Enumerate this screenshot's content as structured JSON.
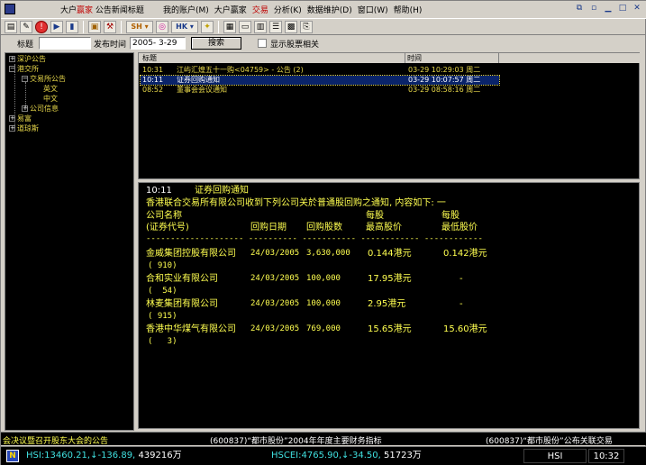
{
  "window": {
    "title_prefix": "大户",
    "title_brand": "赢家",
    "title_suffix": "公告新闻标题",
    "controls": [
      "⧉",
      "▫",
      "▁",
      "□",
      "✕"
    ]
  },
  "menu": [
    {
      "label": "我的账户(M)",
      "active": false
    },
    {
      "label": "大户赢家",
      "active": false
    },
    {
      "label": "交易",
      "active": true
    },
    {
      "label": "分析(K)",
      "active": false
    },
    {
      "label": "数据维护(D)",
      "active": false
    },
    {
      "label": "窗口(W)",
      "active": false
    },
    {
      "label": "帮助(H)",
      "active": false
    }
  ],
  "toolbar": {
    "sh_label": "SH ▾",
    "index_label": "HK ▾"
  },
  "filter": {
    "title_label": "标题",
    "title_value": "",
    "date_label": "发布时间",
    "date_value": "2005- 3-29",
    "search_label": "搜索",
    "related_label": "显示股票相关"
  },
  "tree": {
    "items": [
      {
        "label": "深沪公告",
        "box": "+"
      },
      {
        "label": "港交所",
        "box": "−"
      },
      {
        "label": "交易所公告",
        "box": "−"
      },
      {
        "label": "英文",
        "box": ""
      },
      {
        "label": "中文",
        "box": ""
      },
      {
        "label": "公司信息",
        "box": "+"
      },
      {
        "label": "易富",
        "box": "+"
      },
      {
        "label": "道琼斯",
        "box": "+"
      }
    ]
  },
  "news_list": {
    "col_title": "标题",
    "col_time": "时间",
    "rows": [
      {
        "time": "10:31",
        "title": "江屿汇煌五十一购<04759> - 公告 (2)",
        "datetime": "03-29 10:29:03 周二",
        "selected": false
      },
      {
        "time": "10:11",
        "title": "证券回购通知",
        "datetime": "03-29 10:07:57 周二",
        "selected": true
      },
      {
        "time": "08:52",
        "title": "董事会会议通知",
        "datetime": "03-29 08:58:16 周二",
        "selected": false
      }
    ]
  },
  "detail": {
    "time": "10:11",
    "heading": "证券回购通知",
    "intro": "香港联合交易所有限公司收到下列公司关於普通股回购之通知, 内容如下: 一",
    "col_company": "公司名称",
    "col_code": "(证券代号)",
    "col_date": "回购日期",
    "col_shares": "回购股数",
    "col_high_top": "每股",
    "col_high": "最高股价",
    "col_low_top": "每股",
    "col_low": "最低股价",
    "dashes": "-------------------- ---------- ----------- ------------ ------------",
    "rows": [
      {
        "company": "金威集团控股有限公司",
        "code": "( 910)",
        "date": "24/03/2005",
        "shares": "3,630,000",
        "high": "0.144港元",
        "low": "0.142港元"
      },
      {
        "company": "合和实业有限公司",
        "code": "(  54)",
        "date": "24/03/2005",
        "shares": "100,000",
        "high": "17.95港元",
        "low": "-"
      },
      {
        "company": "林麦集团有限公司",
        "code": "( 915)",
        "date": "24/03/2005",
        "shares": "100,000",
        "high": "2.95港元",
        "low": "-"
      },
      {
        "company": "香港中华煤气有限公司",
        "code": "(   3)",
        "date": "24/03/2005",
        "shares": "769,000",
        "high": "15.65港元",
        "low": "15.60港元"
      }
    ]
  },
  "ticker": {
    "left": "会决议暨召开股东大会的公告",
    "mid": "(600837)“都市股份”2004年年度主要财务指标",
    "right": "(600837)“都市股份”公布关联交易"
  },
  "status": {
    "logo": "N",
    "hsi": "HSI:13460.21,↓-136.89,",
    "hsi_vol": "439216万",
    "hscei": "HSCEI:4765.90,↓-34.50,",
    "hscei_vol": "51723万",
    "index": "HSI",
    "clock": "10:32"
  },
  "colors": {
    "text_yellow": "#ffff50",
    "highlight": "#0a246a",
    "menu_active": "#c00000",
    "down_red": "#ff4040",
    "index_cyan": "#40e0e0"
  }
}
